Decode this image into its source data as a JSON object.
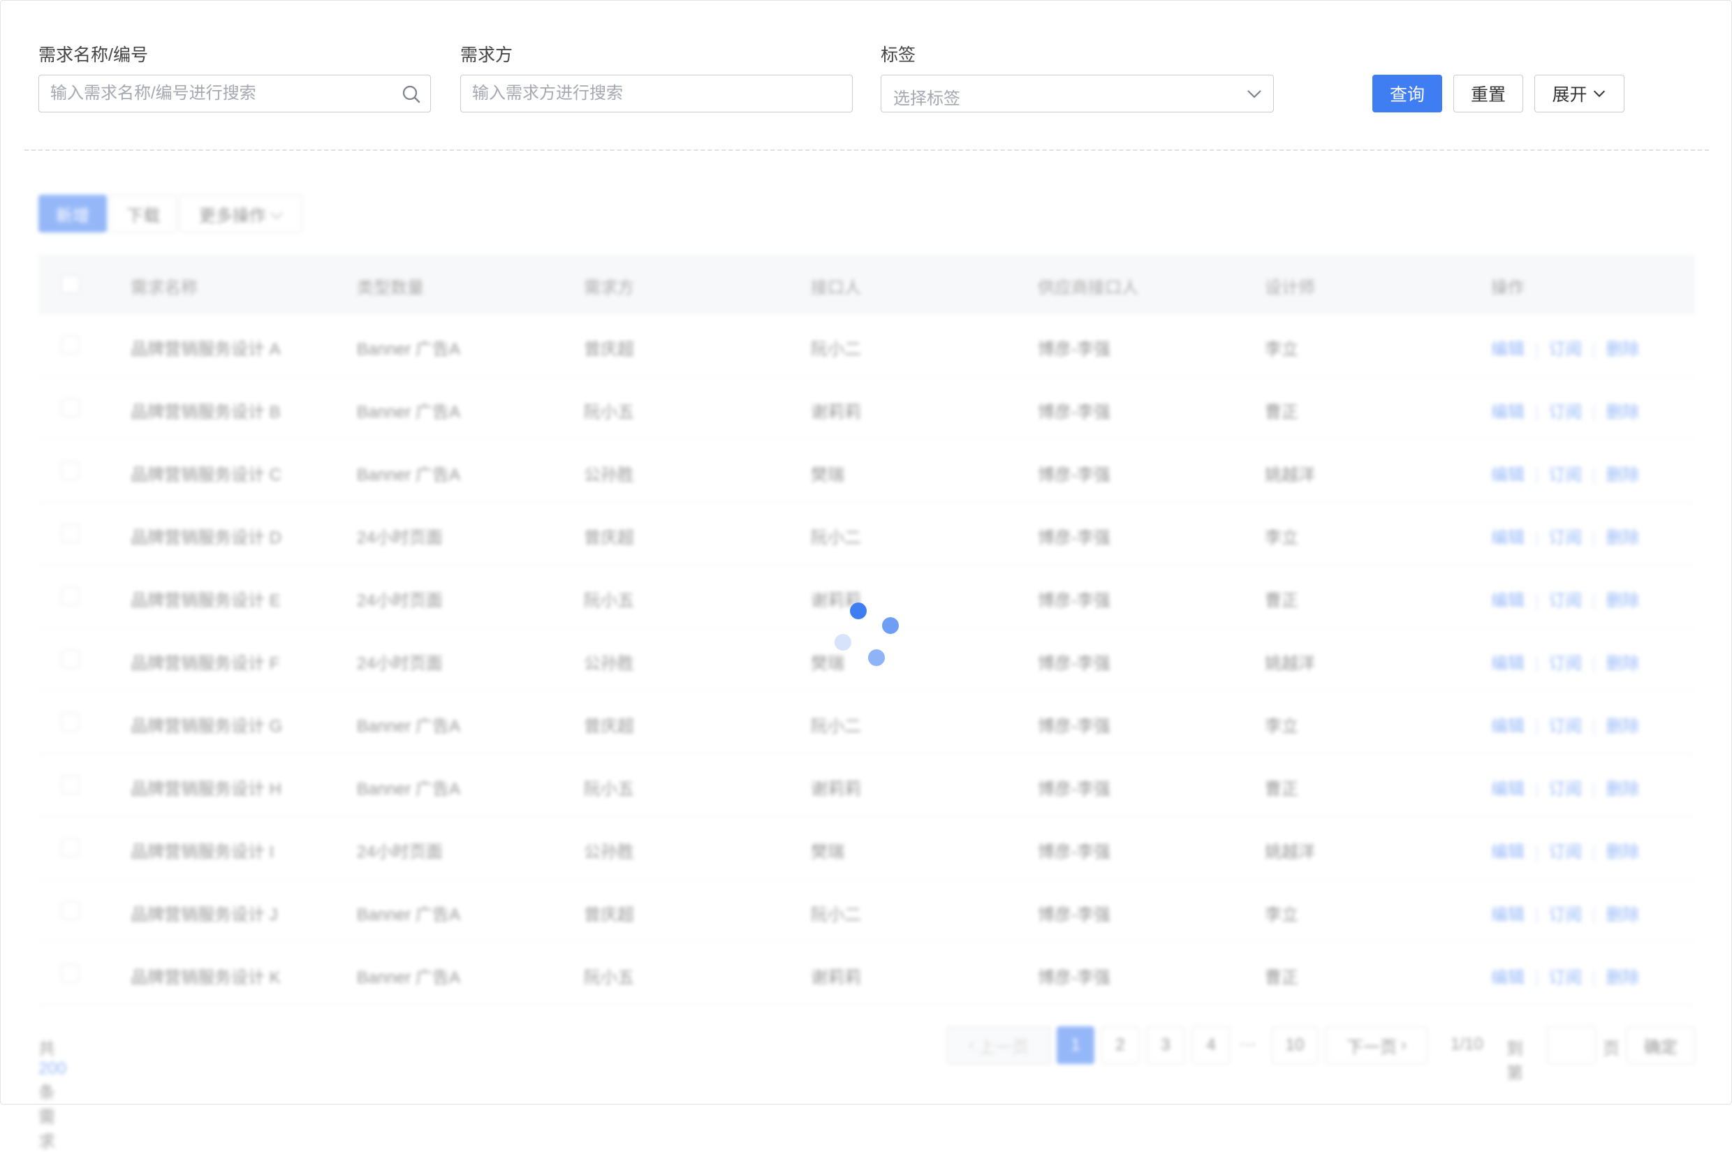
{
  "search": {
    "name_label": "需求名称/编号",
    "name_placeholder": "输入需求名称/编号进行搜索",
    "requester_label": "需求方",
    "requester_placeholder": "输入需求方进行搜索",
    "tag_label": "标签",
    "tag_placeholder": "选择标签",
    "query_button": "查询",
    "reset_button": "重置",
    "expand_button": "展开"
  },
  "toolbar": {
    "add_button": "新增",
    "download_button": "下载",
    "more_button": "更多操作"
  },
  "table": {
    "headers": [
      "需求名称",
      "类型数量",
      "需求方",
      "接口人",
      "供应商接口人",
      "设计师",
      "操作"
    ],
    "rows": [
      [
        "品牌营销服务设计 A",
        "Banner 广告A",
        "曾庆超",
        "阮小二",
        "博彦-李强",
        "李立"
      ],
      [
        "品牌营销服务设计 B",
        "Banner 广告A",
        "阮小五",
        "谢莉莉",
        "博彦-李强",
        "曹正"
      ],
      [
        "品牌营销服务设计 C",
        "Banner 广告A",
        "公孙胜",
        "樊瑞",
        "博彦-李强",
        "姚越洋"
      ],
      [
        "品牌营销服务设计 D",
        "24小时页面",
        "曾庆超",
        "阮小二",
        "博彦-李强",
        "李立"
      ],
      [
        "品牌营销服务设计 E",
        "24小时页面",
        "阮小五",
        "谢莉莉",
        "博彦-李强",
        "曹正"
      ],
      [
        "品牌营销服务设计 F",
        "24小时页面",
        "公孙胜",
        "樊瑞",
        "博彦-李强",
        "姚越洋"
      ],
      [
        "品牌营销服务设计 G",
        "Banner 广告A",
        "曾庆超",
        "阮小二",
        "博彦-李强",
        "李立"
      ],
      [
        "品牌营销服务设计 H",
        "Banner 广告A",
        "阮小五",
        "谢莉莉",
        "博彦-李强",
        "曹正"
      ],
      [
        "品牌营销服务设计 I",
        "24小时页面",
        "公孙胜",
        "樊瑞",
        "博彦-李强",
        "姚越洋"
      ],
      [
        "品牌营销服务设计 J",
        "Banner 广告A",
        "曾庆超",
        "阮小二",
        "博彦-李强",
        "李立"
      ],
      [
        "品牌营销服务设计 K",
        "Banner 广告A",
        "阮小五",
        "谢莉莉",
        "博彦-李强",
        "曹正"
      ]
    ],
    "actions": [
      "编辑",
      "订阅",
      "删除"
    ]
  },
  "pagination": {
    "total_prefix": "共",
    "total_count": "200",
    "total_suffix": "条需求",
    "prev": "上一页",
    "pages": [
      "1",
      "2",
      "3",
      "4"
    ],
    "ellipsis": "···",
    "last_page": "10",
    "next": "下一页",
    "page_info": "1/10",
    "goto_label": "到第",
    "page_unit": "页",
    "confirm": "确定"
  },
  "colors": {
    "primary": "#3f7df2"
  }
}
